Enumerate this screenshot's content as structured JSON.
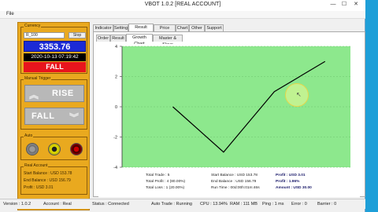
{
  "window": {
    "title": "VBOT 1.0.2 [REAL ACCOUNT]",
    "minimize": "—",
    "maximize": "☐",
    "close": "✕"
  },
  "menu": {
    "file": "File"
  },
  "currency": {
    "title": "Currency",
    "selected": "R_100",
    "stop_label": "Stop",
    "price": "3353.76",
    "datetime": "2020-10-13 07:19:42",
    "signal": "FALL"
  },
  "manual_trigger": {
    "title": "Manual Trigger",
    "rise_label": "RISE",
    "fall_label": "FALL"
  },
  "auto": {
    "title": "Auto"
  },
  "real_account": {
    "title": "Real Account",
    "start_balance": "Start Balance : USD 153.78",
    "end_balance": "End Balance : USD 156.79",
    "profit": "Profit : USD 3.01"
  },
  "tabs": [
    "Indicator",
    "Setting",
    "Result Table",
    "Price Table",
    "Chart",
    "Other",
    "Support"
  ],
  "subtabs": [
    "Order",
    "Result",
    "Growth Chart",
    "Master & Slave"
  ],
  "chart_data": {
    "type": "line",
    "x": [
      0,
      1,
      2,
      3
    ],
    "values": [
      0,
      -3,
      1,
      3
    ],
    "yticks": [
      "4",
      "2",
      "0",
      "-2",
      "-4"
    ],
    "ylim": [
      -4,
      4
    ],
    "line_color": "#000000",
    "background": "#8de88d"
  },
  "stats": {
    "total_trade": "Total Trade : 5",
    "total_profit": "Total Profit : 4 (80.00%)",
    "total_loss": "Total Loss : 1 (20.00%)",
    "start_balance": "Start Balance : USD 153.78",
    "end_balance": "End Balance : USD 156.79",
    "run_time": "Run Time : 00d:00h:01m:46s",
    "profit": "Profit : USD 3.01",
    "profit_pct": "Profit : 1.96%",
    "amount": "Amount : USD 30.00"
  },
  "status": {
    "version": "Version : 1.0.2",
    "account": "Account : Real",
    "status": "Status : Connected",
    "auto_trade": "Auto Trade : Running",
    "cpu": "CPU : 13.94%",
    "ram": "RAM : 111 MB",
    "ping": "Ping : 1 ms",
    "error": "Error : 0",
    "barrier": "Barrier : 0"
  }
}
